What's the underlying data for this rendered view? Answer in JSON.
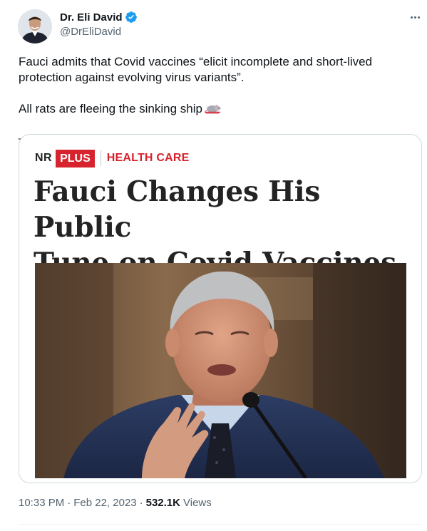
{
  "author": {
    "display_name": "Dr. Eli David",
    "handle": "@DrEliDavid",
    "verified": true,
    "avatar_icon": "profile-photo"
  },
  "tweet": {
    "paragraph1": "Fauci admits that Covid vaccines “elicit incomplete and short-lived protection against evolving virus variants”.",
    "paragraph2": "All rats are fleeing the sinking ship",
    "paragraph2_emoji": "rat-emoji",
    "paragraph3": "_"
  },
  "media": {
    "brand": "NR",
    "plus_label": "PLUS",
    "section": "HEALTH CARE",
    "headline_line1": "Fauci Changes His Public",
    "headline_line2": "Tune on Covid Vaccines",
    "photo_desc_icon": "article-photo"
  },
  "meta": {
    "time": "10:33 PM",
    "date": "Feb 22, 2023",
    "views_count": "532.1K",
    "views_label": "Views"
  },
  "colors": {
    "accent_red": "#d7232e",
    "verified_blue": "#1d9bf0",
    "secondary_text": "#536471"
  }
}
